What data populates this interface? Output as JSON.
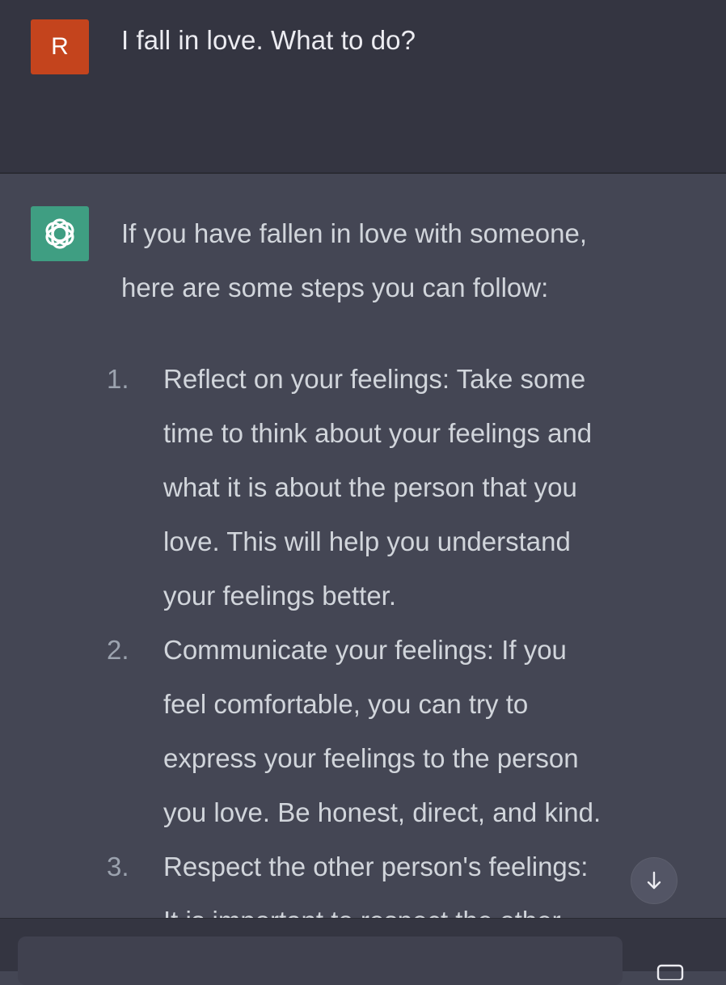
{
  "user_message": {
    "avatar_letter": "R",
    "text": "I fall in love. What to do?"
  },
  "assistant_message": {
    "avatar_icon": "openai-logo-icon",
    "intro_lines": [
      "If you have fallen in love with someone,",
      "here are some steps you can follow:"
    ],
    "steps": [
      {
        "number": "1.",
        "lines": [
          "Reflect on your feelings: Take some",
          "time to think about your feelings and",
          "what it is about the person that you",
          "love. This will help you understand",
          "your feelings better."
        ]
      },
      {
        "number": "2.",
        "lines": [
          "Communicate your feelings: If you",
          "feel comfortable, you can try to",
          "express your feelings to the person",
          "you love. Be honest, direct, and kind."
        ]
      },
      {
        "number": "3.",
        "lines": [
          "Respect the other person's feelings:",
          "It is important to respect the other"
        ]
      }
    ]
  },
  "scroll_button": {
    "icon": "arrow-down-icon"
  },
  "composer": {
    "value": ""
  },
  "colors": {
    "user_bg": "#343541",
    "assistant_bg": "#444654",
    "user_avatar": "#c4441d",
    "bot_avatar": "#3f9e82"
  }
}
